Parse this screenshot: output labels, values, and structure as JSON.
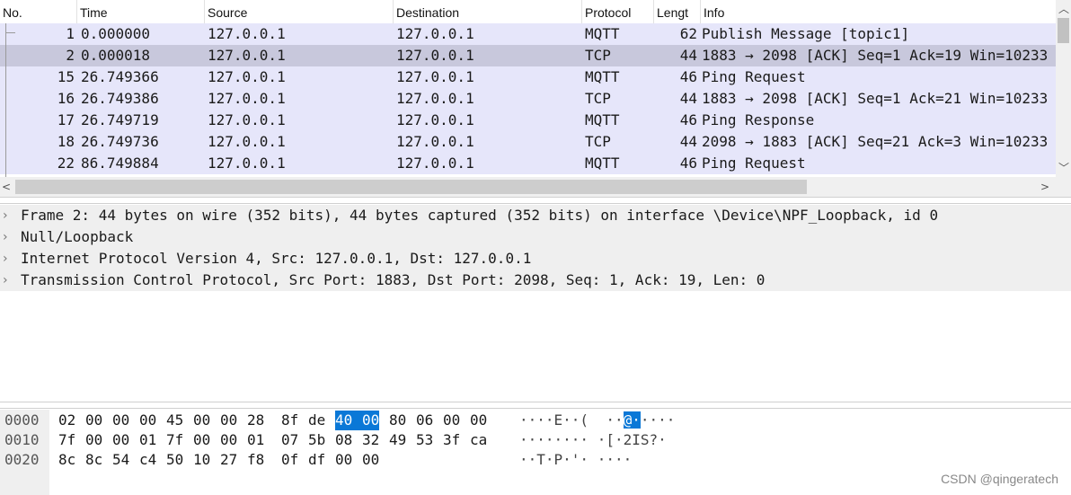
{
  "packet_list": {
    "columns": [
      "No.",
      "Time",
      "Source",
      "Destination",
      "Protocol",
      "Lengt",
      "Info"
    ],
    "rows": [
      {
        "no": "1",
        "time": "0.000000",
        "source": "127.0.0.1",
        "destination": "127.0.0.1",
        "protocol": "MQTT",
        "length": "62",
        "info": "Publish Message [topic1]",
        "selected": false
      },
      {
        "no": "2",
        "time": "0.000018",
        "source": "127.0.0.1",
        "destination": "127.0.0.1",
        "protocol": "TCP",
        "length": "44",
        "info": "1883 → 2098 [ACK] Seq=1 Ack=19 Win=10233",
        "selected": true
      },
      {
        "no": "15",
        "time": "26.749366",
        "source": "127.0.0.1",
        "destination": "127.0.0.1",
        "protocol": "MQTT",
        "length": "46",
        "info": "Ping Request",
        "selected": false
      },
      {
        "no": "16",
        "time": "26.749386",
        "source": "127.0.0.1",
        "destination": "127.0.0.1",
        "protocol": "TCP",
        "length": "44",
        "info": "1883 → 2098 [ACK] Seq=1 Ack=21 Win=10233",
        "selected": false
      },
      {
        "no": "17",
        "time": "26.749719",
        "source": "127.0.0.1",
        "destination": "127.0.0.1",
        "protocol": "MQTT",
        "length": "46",
        "info": "Ping Response",
        "selected": false
      },
      {
        "no": "18",
        "time": "26.749736",
        "source": "127.0.0.1",
        "destination": "127.0.0.1",
        "protocol": "TCP",
        "length": "44",
        "info": "2098 → 1883 [ACK] Seq=21 Ack=3 Win=10233",
        "selected": false
      },
      {
        "no": "22",
        "time": "86.749884",
        "source": "127.0.0.1",
        "destination": "127.0.0.1",
        "protocol": "MQTT",
        "length": "46",
        "info": "Ping Request",
        "selected": false
      }
    ],
    "row_color": "#e6e6fa",
    "selected_row_color": "#c8c8dc"
  },
  "detail_pane": {
    "items": [
      "Frame 2: 44 bytes on wire (352 bits), 44 bytes captured (352 bits) on interface \\Device\\NPF_Loopback, id 0",
      "Null/Loopback",
      "Internet Protocol Version 4, Src: 127.0.0.1, Dst: 127.0.0.1",
      "Transmission Control Protocol, Src Port: 1883, Dst Port: 2098, Seq: 1, Ack: 19, Len: 0"
    ],
    "expander_icon": "chevron-right-icon"
  },
  "hex_pane": {
    "lines": [
      {
        "offset": "0000",
        "bytes": [
          "02",
          "00",
          "00",
          "00",
          "45",
          "00",
          "00",
          "28",
          "8f",
          "de",
          "40",
          "00",
          "80",
          "06",
          "00",
          "00"
        ],
        "highlight": [
          10,
          11
        ],
        "ascii": "····E··(  ··@·····"
      },
      {
        "offset": "0010",
        "bytes": [
          "7f",
          "00",
          "00",
          "01",
          "7f",
          "00",
          "00",
          "01",
          "07",
          "5b",
          "08",
          "32",
          "49",
          "53",
          "3f",
          "ca"
        ],
        "highlight": [],
        "ascii": "········ ·[·2IS?·"
      },
      {
        "offset": "0020",
        "bytes": [
          "8c",
          "8c",
          "54",
          "c4",
          "50",
          "10",
          "27",
          "f8",
          "0f",
          "df",
          "00",
          "00"
        ],
        "highlight": [],
        "ascii": "··T·P·'· ····"
      }
    ],
    "highlight_color": "#0a78d7"
  },
  "watermark": "CSDN @qingeratech"
}
